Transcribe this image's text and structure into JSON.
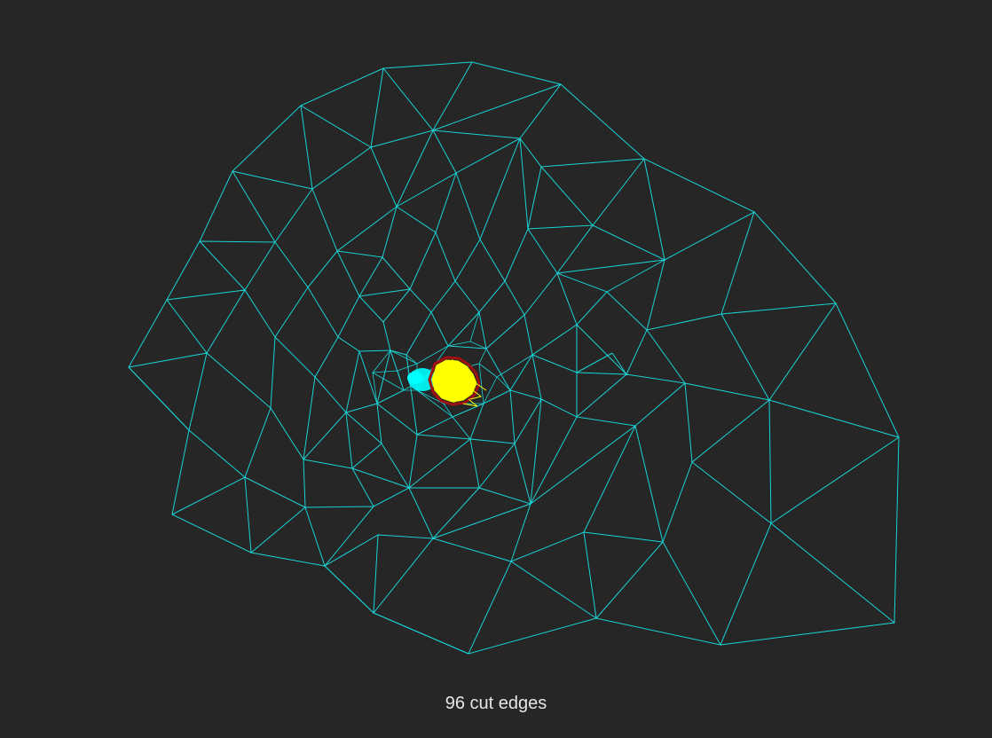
{
  "caption": "96 cut edges",
  "colors": {
    "background": "#262626",
    "mesh_edges": "#19d3d6",
    "partition_subdomain": "#ffff00",
    "cut_boundary": "#a01010",
    "dense_core": "#00ffff",
    "caption_text": "#e6e6e6"
  }
}
